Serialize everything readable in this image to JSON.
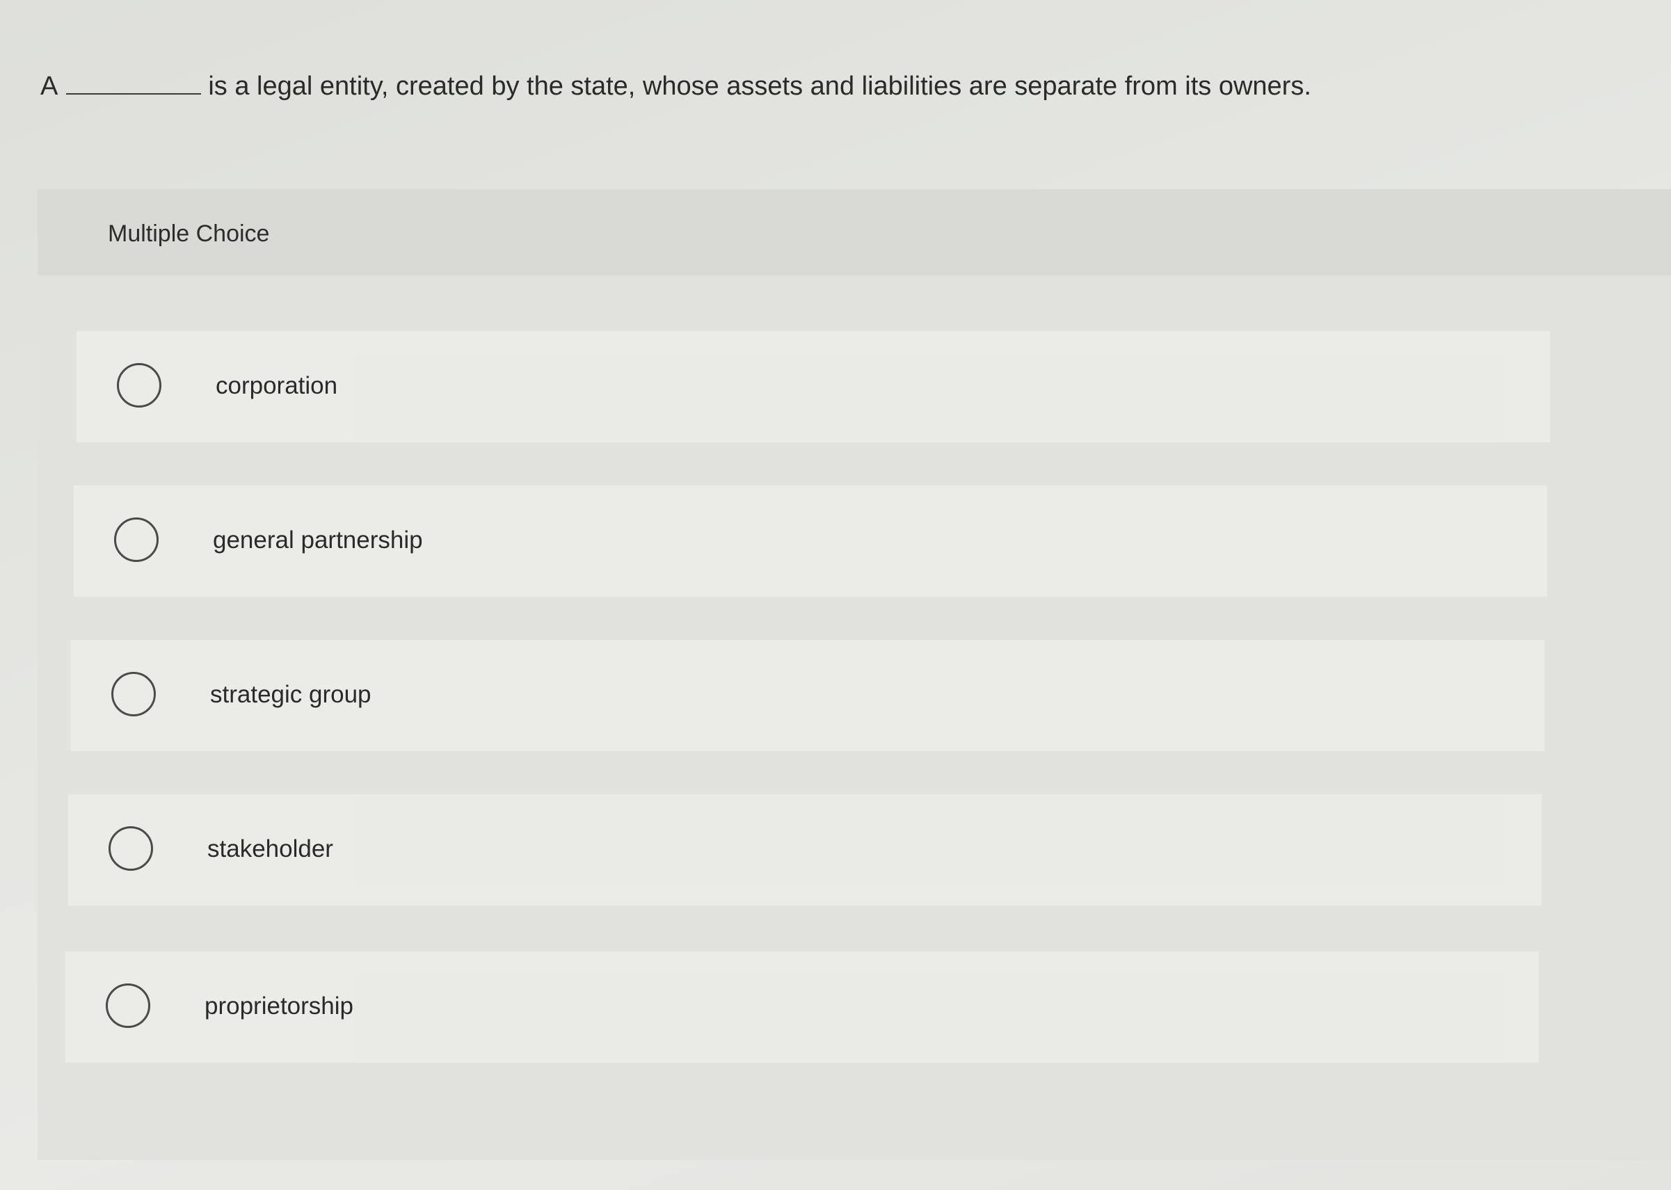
{
  "question": {
    "lead": "A",
    "text": "is a legal entity, created by the state, whose assets and liabilities are separate from its owners."
  },
  "multiple_choice": {
    "label": "Multiple Choice",
    "options": [
      {
        "label": "corporation",
        "selected": false
      },
      {
        "label": "general partnership",
        "selected": false
      },
      {
        "label": "strategic group",
        "selected": false
      },
      {
        "label": "stakeholder",
        "selected": false
      },
      {
        "label": "proprietorship",
        "selected": false
      }
    ]
  },
  "colors": {
    "text": "#2a2a2a",
    "radio_border": "#4a4a4a",
    "panel_background": "#e1e2de",
    "header_background": "#d9dad6"
  }
}
